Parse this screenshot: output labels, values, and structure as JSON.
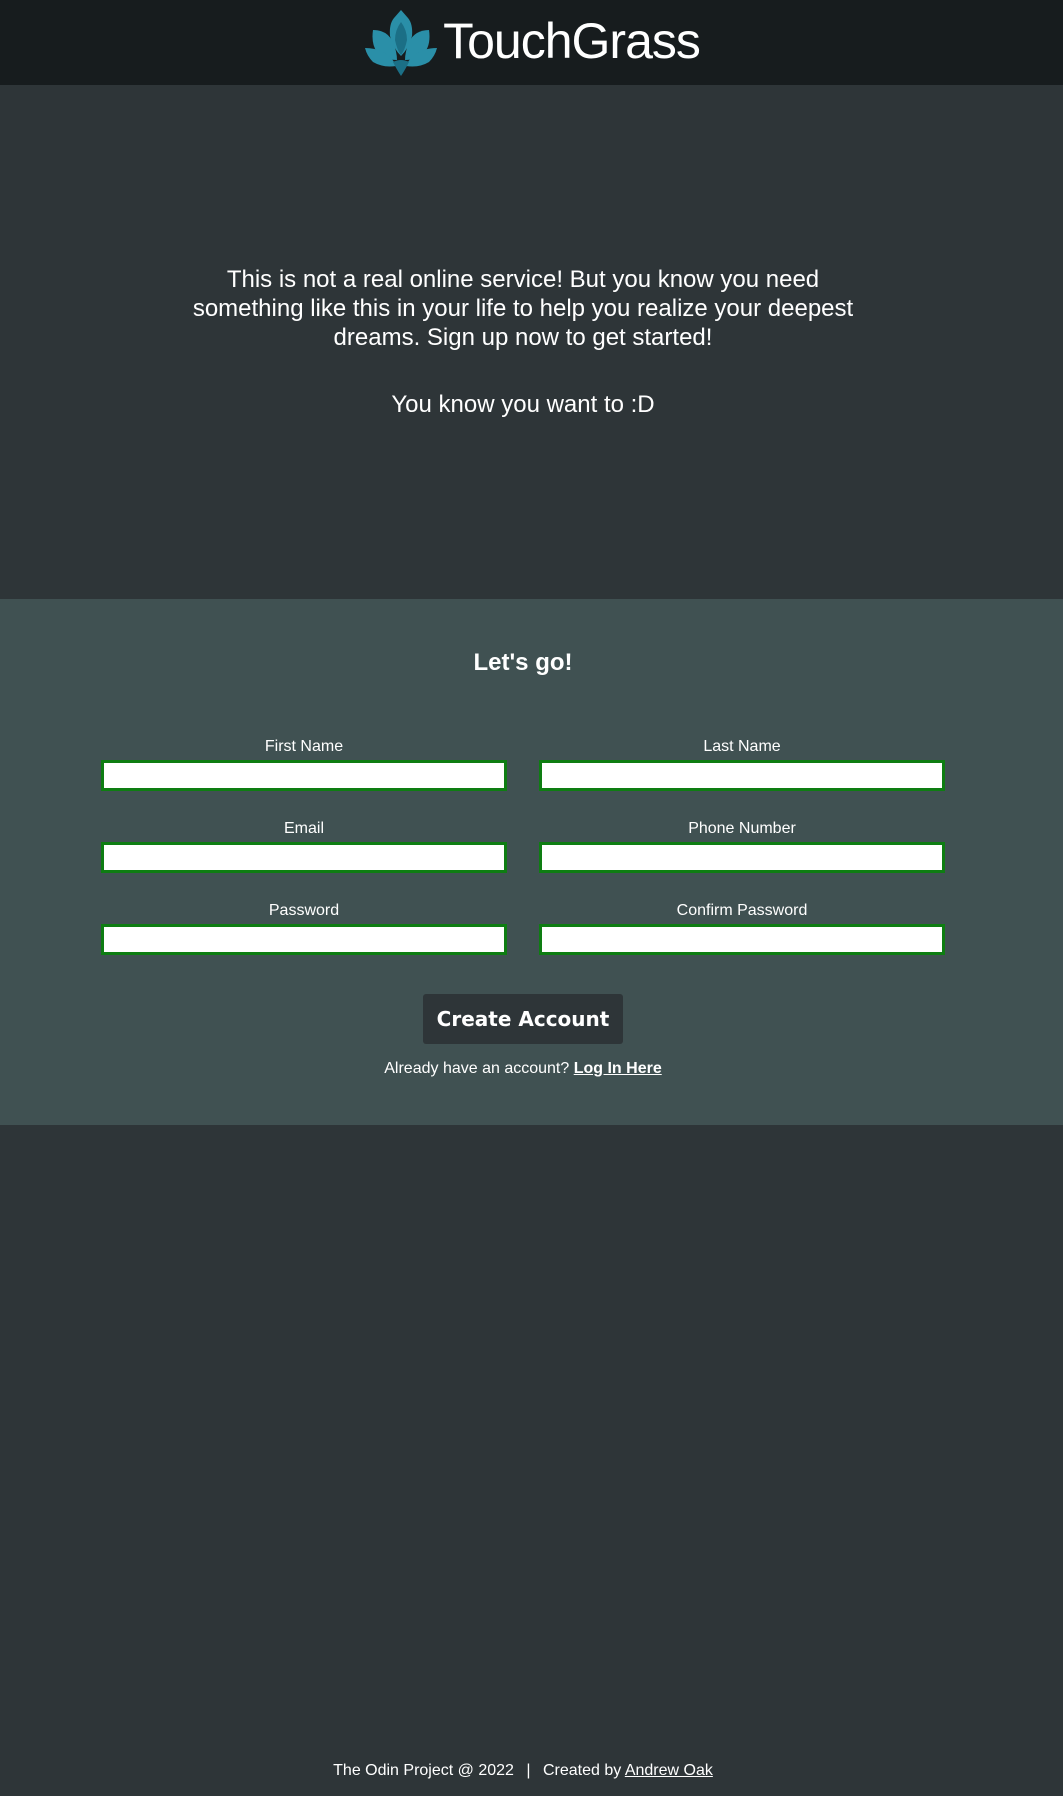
{
  "header": {
    "brand_name": "TouchGrass",
    "logo_icon": "lotus-icon",
    "logo_color": "#2a8fa8"
  },
  "hero": {
    "text": "This is not a real online service! But you know you need something like this in your life to help you realize your deepest dreams. Sign up now to get started!",
    "subtext": "You know you want to :D"
  },
  "signup": {
    "title": "Let's go!",
    "fields": {
      "first_name": {
        "label": "First Name",
        "value": ""
      },
      "last_name": {
        "label": "Last Name",
        "value": ""
      },
      "email": {
        "label": "Email",
        "value": ""
      },
      "phone": {
        "label": "Phone Number",
        "value": ""
      },
      "password": {
        "label": "Password",
        "value": ""
      },
      "confirm_password": {
        "label": "Confirm Password",
        "value": ""
      }
    },
    "create_button": "Create Account",
    "login_prompt": "Already have an account?",
    "login_link": "Log In Here"
  },
  "footer": {
    "copyright": "The Odin Project @ 2022",
    "separator": "|",
    "created_by": "Created by",
    "author": "Andrew Oak"
  },
  "colors": {
    "header_bg": "#171c1e",
    "page_bg": "#2e3538",
    "form_bg": "#405152",
    "input_border": "#0e7d12"
  }
}
